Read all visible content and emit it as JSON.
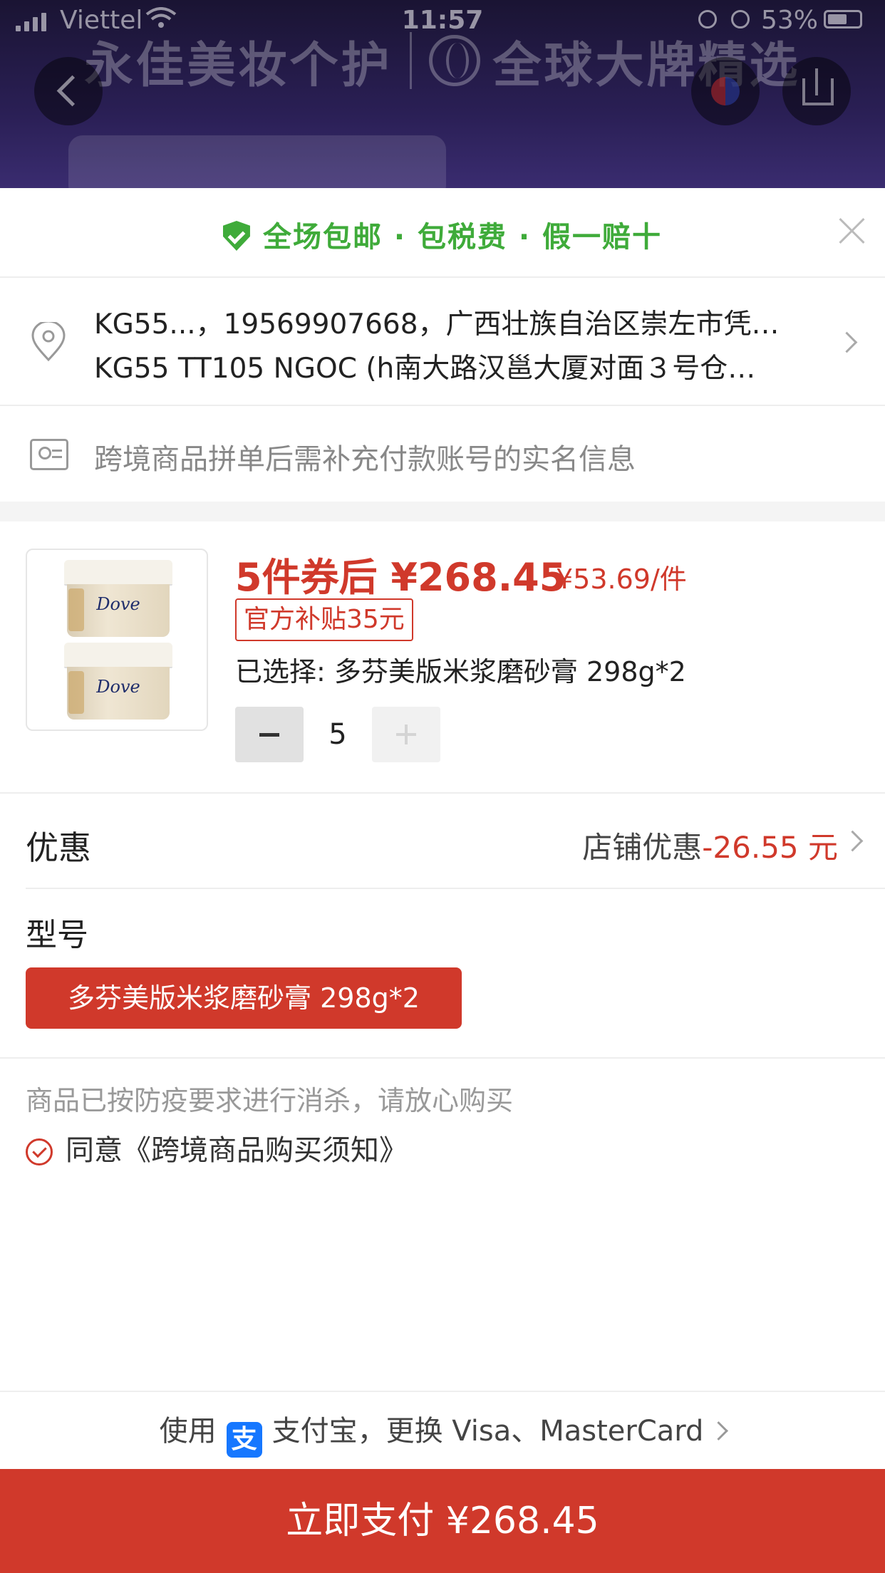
{
  "status_bar": {
    "carrier": "Viettel",
    "time": "11:57",
    "battery": "53%"
  },
  "background": {
    "banner_left": "永佳美妆个护",
    "banner_right": "全球大牌精选"
  },
  "promo": {
    "text": "全场包邮 · 包税费 · 假一赔十",
    "color": "#3fab3a"
  },
  "address": {
    "line1": "KG55...，19569907668，广西壮族自治区崇左市凭…",
    "line2": "KG55 TT105 NGOC (h南大路汉邕大厦对面３号仓…"
  },
  "realname_hint": "跨境商品拼单后需补充付款账号的实名信息",
  "product": {
    "image_brand": "Dove",
    "price_main": "5件券后 ¥268.45",
    "price_unit": "¥53.69/件",
    "subsidy": "官方补贴35元",
    "selected": "已选择: 多芬美版米浆磨砂膏 298g*2",
    "quantity": "5"
  },
  "discount": {
    "label": "优惠",
    "value_label": "店铺优惠",
    "value_amount": "-26.55 元"
  },
  "model": {
    "label": "型号",
    "option": "多芬美版米浆磨砂膏 298g*2"
  },
  "notice": "商品已按防疫要求进行消杀，请放心购买",
  "agreement": "同意《跨境商品购买须知》",
  "payment": {
    "prefix": "使用",
    "alipay_glyph": "支",
    "method": "支付宝，更换 Visa、MasterCard",
    "button": "立即支付 ¥268.45"
  },
  "colors": {
    "accent": "#d0392b",
    "green": "#3fab3a",
    "alipay": "#1677ff"
  }
}
